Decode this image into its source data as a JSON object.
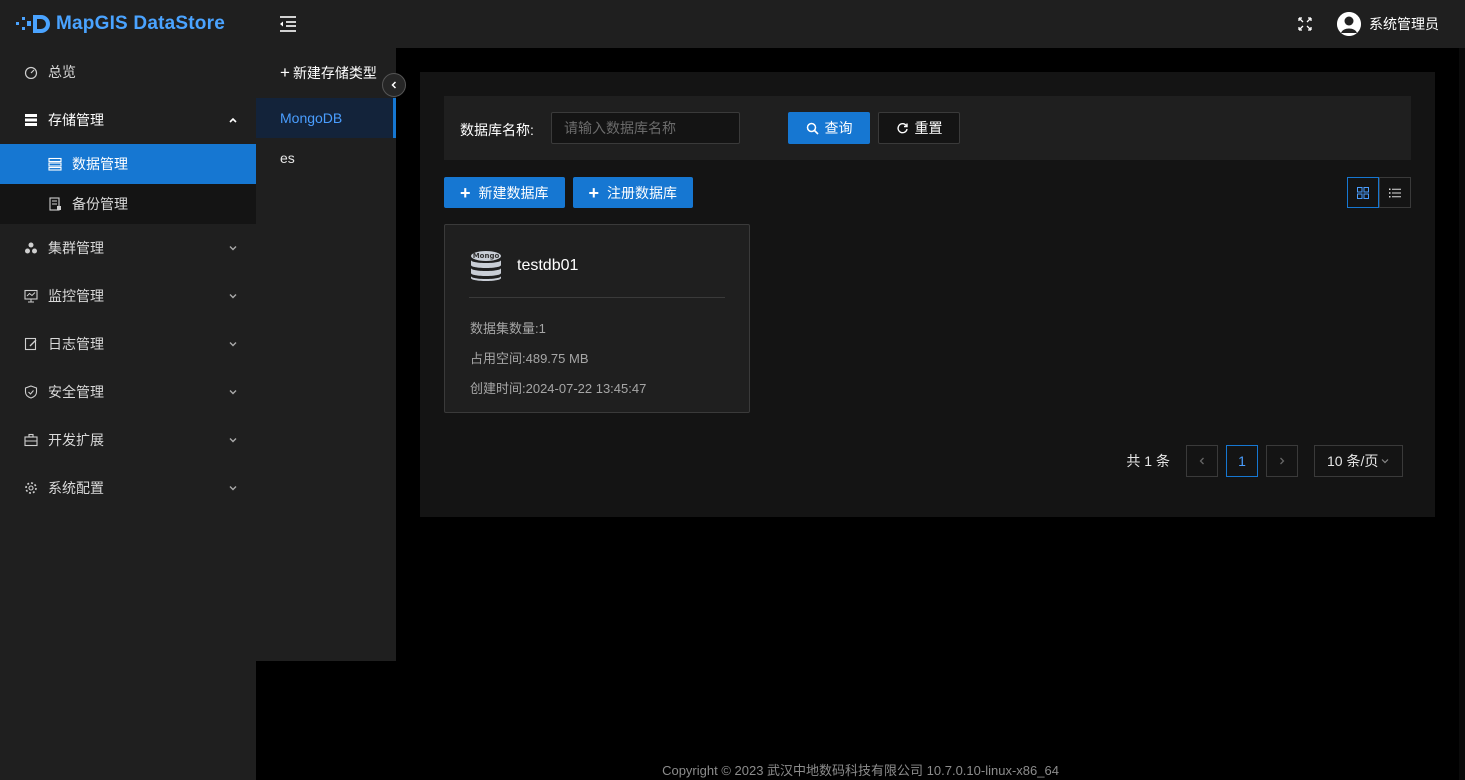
{
  "app": {
    "title": "MapGIS DataStore"
  },
  "sidebar": {
    "items": [
      {
        "label": "总览",
        "icon": "dashboard-icon"
      },
      {
        "label": "存储管理",
        "icon": "storage-icon",
        "expanded": true,
        "children": [
          {
            "label": "数据管理",
            "icon": "data-manage-icon",
            "active": true
          },
          {
            "label": "备份管理",
            "icon": "backup-icon"
          }
        ]
      },
      {
        "label": "集群管理",
        "icon": "cluster-icon"
      },
      {
        "label": "监控管理",
        "icon": "monitor-icon"
      },
      {
        "label": "日志管理",
        "icon": "log-icon"
      },
      {
        "label": "安全管理",
        "icon": "shield-icon"
      },
      {
        "label": "开发扩展",
        "icon": "toolbox-icon"
      },
      {
        "label": "系统配置",
        "icon": "gear-icon"
      }
    ]
  },
  "header": {
    "user_name": "系统管理员"
  },
  "storage_types": {
    "new_label": "新建存储类型",
    "items": [
      "MongoDB",
      "es"
    ],
    "active": "MongoDB"
  },
  "filter": {
    "label": "数据库名称:",
    "placeholder": "请输入数据库名称",
    "value": "",
    "query_label": "查询",
    "reset_label": "重置"
  },
  "actions": {
    "new_db_label": "新建数据库",
    "register_db_label": "注册数据库"
  },
  "cards": [
    {
      "icon_text": "Mongo",
      "title": "testdb01",
      "dataset_count": "数据集数量:1",
      "space": "占用空间:489.75 MB",
      "created": "创建时间:2024-07-22 13:45:47"
    }
  ],
  "pagination": {
    "total_text": "共 1 条",
    "current_page": "1",
    "page_size": "10 条/页"
  },
  "footer": {
    "copyright": "Copyright © 2023 武汉中地数码科技有限公司 10.7.0.10-linux-x86_64"
  },
  "colors": {
    "accent": "#1677d2",
    "panel": "#1f1f1f",
    "bg": "#000000"
  }
}
